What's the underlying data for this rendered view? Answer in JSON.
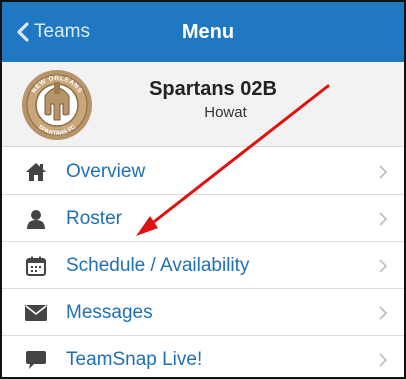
{
  "navbar": {
    "back_label": "Teams",
    "title": "Menu",
    "accent_color": "#1f78c1"
  },
  "team": {
    "name": "Spartans 02B",
    "subtitle": "Howat",
    "logo_text_top": "NEW ORLEANS",
    "logo_text_bottom": "SPARTANS FC"
  },
  "menu": {
    "items": [
      {
        "label": "Overview",
        "icon": "home-icon"
      },
      {
        "label": "Roster",
        "icon": "person-icon"
      },
      {
        "label": "Schedule / Availability",
        "icon": "calendar-icon"
      },
      {
        "label": "Messages",
        "icon": "envelope-icon"
      },
      {
        "label": "TeamSnap Live!",
        "icon": "chat-bubble-icon"
      }
    ]
  },
  "annotation": {
    "color": "#e01010"
  }
}
